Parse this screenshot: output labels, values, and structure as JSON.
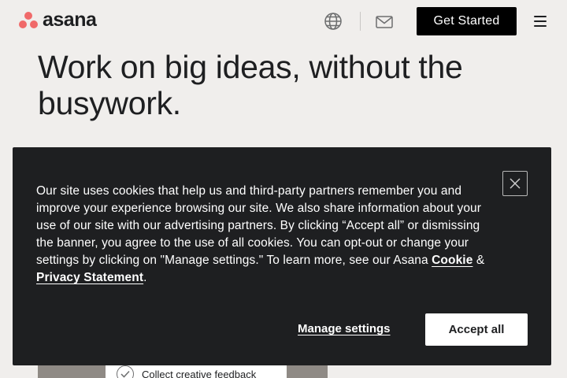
{
  "header": {
    "logo_text": "asana",
    "cta_label": "Get Started",
    "icons": {
      "language": "globe-icon",
      "contact": "mail-icon",
      "menu": "hamburger-menu-icon"
    }
  },
  "hero": {
    "title": "Work on big ideas, without the busywork."
  },
  "media": {
    "card_label": "Collect creative feedback"
  },
  "cookie_banner": {
    "text": "Our site uses cookies that help us and third-party partners remember you and improve your experience browsing our site. We also share information about your use of our site with our advertising partners. By clicking “Accept all” or dismissing the banner, you agree to the use of all cookies. You can opt-out or change your settings by clicking on \"Manage settings.\" To learn more, see our Asana ",
    "cookie_link": "Cookie",
    "amp": " & ",
    "privacy_link": "Privacy Statement",
    "period": ".",
    "manage_label": "Manage settings",
    "accept_label": "Accept all"
  },
  "colors": {
    "page_bg": "#f0eeec",
    "brand_coral": "#f06a6a",
    "banner_bg": "#1e1f21",
    "cta_bg": "#000000"
  }
}
